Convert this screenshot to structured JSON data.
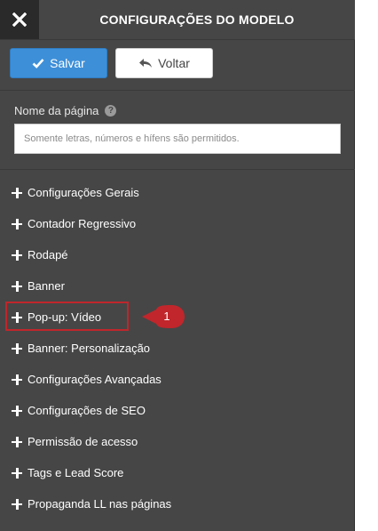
{
  "header": {
    "title": "CONFIGURAÇÕES DO MODELO",
    "close_icon": "close-icon"
  },
  "toolbar": {
    "save_label": "Salvar",
    "back_label": "Voltar"
  },
  "page_name": {
    "label": "Nome da página",
    "value": "",
    "placeholder": "Somente letras, números e hífens são permitidos."
  },
  "menu": {
    "items": [
      {
        "label": "Configurações Gerais"
      },
      {
        "label": "Contador Regressivo"
      },
      {
        "label": "Rodapé"
      },
      {
        "label": "Banner"
      },
      {
        "label": "Pop-up: Vídeo"
      },
      {
        "label": "Banner: Personalização"
      },
      {
        "label": "Configurações Avançadas"
      },
      {
        "label": "Configurações de SEO"
      },
      {
        "label": "Permissão de acesso"
      },
      {
        "label": "Tags e Lead Score"
      },
      {
        "label": "Propaganda LL nas páginas"
      }
    ]
  },
  "annotation": {
    "number": "1",
    "color": "#c0262b"
  },
  "colors": {
    "panel_bg": "#464646",
    "save_button": "#3d8fd8",
    "highlight": "#c0262b"
  }
}
